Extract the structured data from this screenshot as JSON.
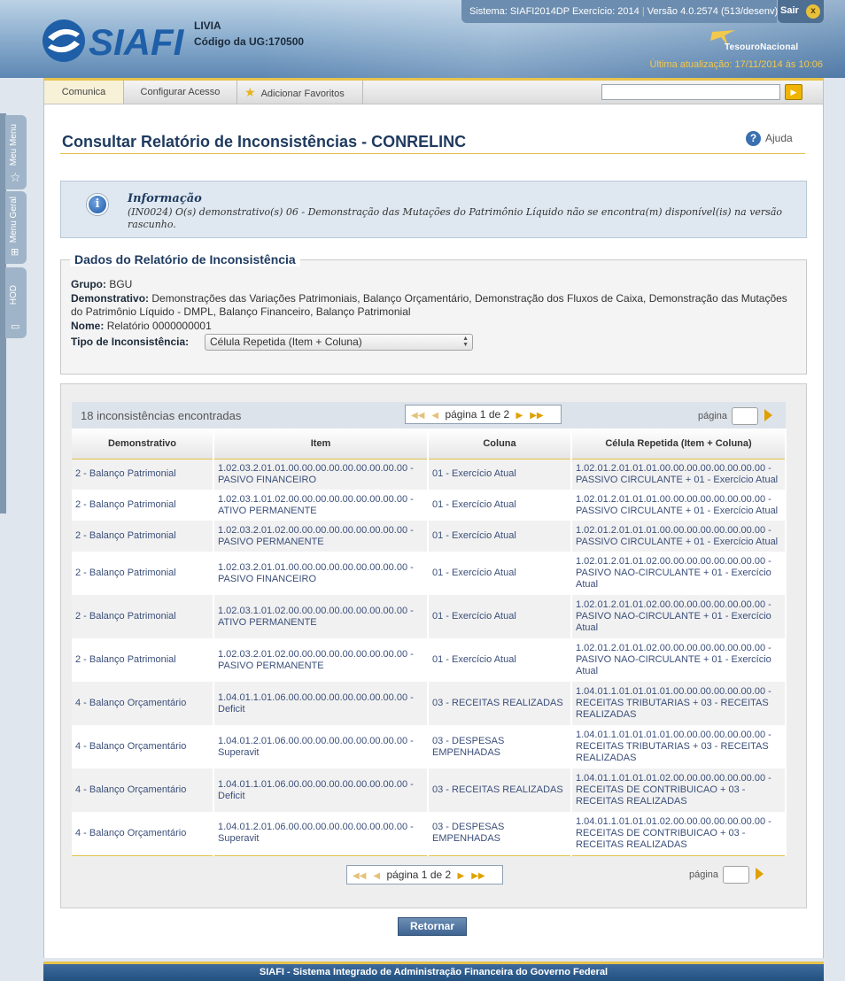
{
  "header": {
    "logo_text": "SIAFI",
    "user_name": "LIVIA",
    "ug_label": "Código da UG:",
    "ug_code": "170500",
    "system_info": "Sistema: SIAFI2014DP Exercício: 2014",
    "version_info": "Versão 4.0.2574 (513/desenv)",
    "exit_label": "Sair",
    "exit_icon": "x",
    "tesouro_label": "TesouroNacional",
    "last_update": "Última atualização: 17/11/2014 às 10:06"
  },
  "sidetabs": [
    "Meu Menu",
    "Menu Geral",
    "HOD"
  ],
  "menu": {
    "items": [
      "Comunica",
      "Configurar Acesso",
      "Adicionar Favoritos"
    ],
    "search_value": ""
  },
  "page": {
    "title": "Consultar Relatório de Inconsistências - CONRELINC",
    "help_label": "Ajuda"
  },
  "info": {
    "title": "Informação",
    "message": "(IN0024) O(s) demonstrativo(s) 06 - Demonstração das Mutações do Patrimônio Líquido não se encontra(m) disponível(is) na versão rascunho."
  },
  "report": {
    "legend": "Dados do Relatório de Inconsistência",
    "grupo_label": "Grupo:",
    "grupo_value": "BGU",
    "demonstrativo_label": "Demonstrativo:",
    "demonstrativo_value": "Demonstrações das Variações Patrimoniais, Balanço Orçamentário, Demonstração dos Fluxos de Caixa, Demonstração das Mutações do Patrimônio Líquido - DMPL, Balanço Financeiro, Balanço Patrimonial",
    "nome_label": "Nome:",
    "nome_value": "Relatório 0000000001",
    "tipo_label": "Tipo de Inconsistência:",
    "tipo_value": "Célula Repetida (Item + Coluna)"
  },
  "results": {
    "count_text": "18 inconsistências encontradas",
    "pager_text": "página 1 de 2",
    "page_label": "página",
    "columns": [
      "Demonstrativo",
      "Item",
      "Coluna",
      "Célula Repetida (Item + Coluna)"
    ],
    "rows": [
      [
        "2 - Balanço Patrimonial",
        "1.02.03.2.01.01.00.00.00.00.00.00.00.00.00 - PASIVO FINANCEIRO",
        "01 - Exercício Atual",
        "1.02.01.2.01.01.01.00.00.00.00.00.00.00.00 - PASSIVO CIRCULANTE + 01 - Exercício Atual"
      ],
      [
        "2 - Balanço Patrimonial",
        "1.02.03.1.01.02.00.00.00.00.00.00.00.00.00 - ATIVO PERMANENTE",
        "01 - Exercício Atual",
        "1.02.01.2.01.01.01.00.00.00.00.00.00.00.00 - PASSIVO CIRCULANTE + 01 - Exercício Atual"
      ],
      [
        "2 - Balanço Patrimonial",
        "1.02.03.2.01.02.00.00.00.00.00.00.00.00.00 - PASIVO PERMANENTE",
        "01 - Exercício Atual",
        "1.02.01.2.01.01.01.00.00.00.00.00.00.00.00 - PASSIVO CIRCULANTE + 01 - Exercício Atual"
      ],
      [
        "2 - Balanço Patrimonial",
        "1.02.03.2.01.01.00.00.00.00.00.00.00.00.00 - PASIVO FINANCEIRO",
        "01 - Exercício Atual",
        "1.02.01.2.01.01.02.00.00.00.00.00.00.00.00 - PASIVO NAO-CIRCULANTE + 01 - Exercício Atual"
      ],
      [
        "2 - Balanço Patrimonial",
        "1.02.03.1.01.02.00.00.00.00.00.00.00.00.00 - ATIVO PERMANENTE",
        "01 - Exercício Atual",
        "1.02.01.2.01.01.02.00.00.00.00.00.00.00.00 - PASIVO NAO-CIRCULANTE + 01 - Exercício Atual"
      ],
      [
        "2 - Balanço Patrimonial",
        "1.02.03.2.01.02.00.00.00.00.00.00.00.00.00 - PASIVO PERMANENTE",
        "01 - Exercício Atual",
        "1.02.01.2.01.01.02.00.00.00.00.00.00.00.00 - PASIVO NAO-CIRCULANTE + 01 - Exercício Atual"
      ],
      [
        "4 - Balanço Orçamentário",
        "1.04.01.1.01.06.00.00.00.00.00.00.00.00.00 - Deficit",
        "03 - RECEITAS REALIZADAS",
        "1.04.01.1.01.01.01.01.00.00.00.00.00.00.00 - RECEITAS TRIBUTARIAS + 03 - RECEITAS REALIZADAS"
      ],
      [
        "4 - Balanço Orçamentário",
        "1.04.01.2.01.06.00.00.00.00.00.00.00.00.00 - Superavit",
        "03 - DESPESAS EMPENHADAS",
        "1.04.01.1.01.01.01.01.00.00.00.00.00.00.00 - RECEITAS TRIBUTARIAS + 03 - RECEITAS REALIZADAS"
      ],
      [
        "4 - Balanço Orçamentário",
        "1.04.01.1.01.06.00.00.00.00.00.00.00.00.00 - Deficit",
        "03 - RECEITAS REALIZADAS",
        "1.04.01.1.01.01.01.02.00.00.00.00.00.00.00 - RECEITAS DE CONTRIBUICAO + 03 - RECEITAS REALIZADAS"
      ],
      [
        "4 - Balanço Orçamentário",
        "1.04.01.2.01.06.00.00.00.00.00.00.00.00.00 - Superavit",
        "03 - DESPESAS EMPENHADAS",
        "1.04.01.1.01.01.01.02.00.00.00.00.00.00.00 - RECEITAS DE CONTRIBUICAO + 03 - RECEITAS REALIZADAS"
      ]
    ]
  },
  "actions": {
    "return_label": "Retornar"
  },
  "footer": {
    "text": "SIAFI - Sistema Integrado de Administração Financeira do Governo Federal"
  },
  "colors": {
    "accent": "#e7c34c",
    "title": "#1e3a5f",
    "link": "#3b4f7a",
    "header_blue": "#5d87b3"
  }
}
